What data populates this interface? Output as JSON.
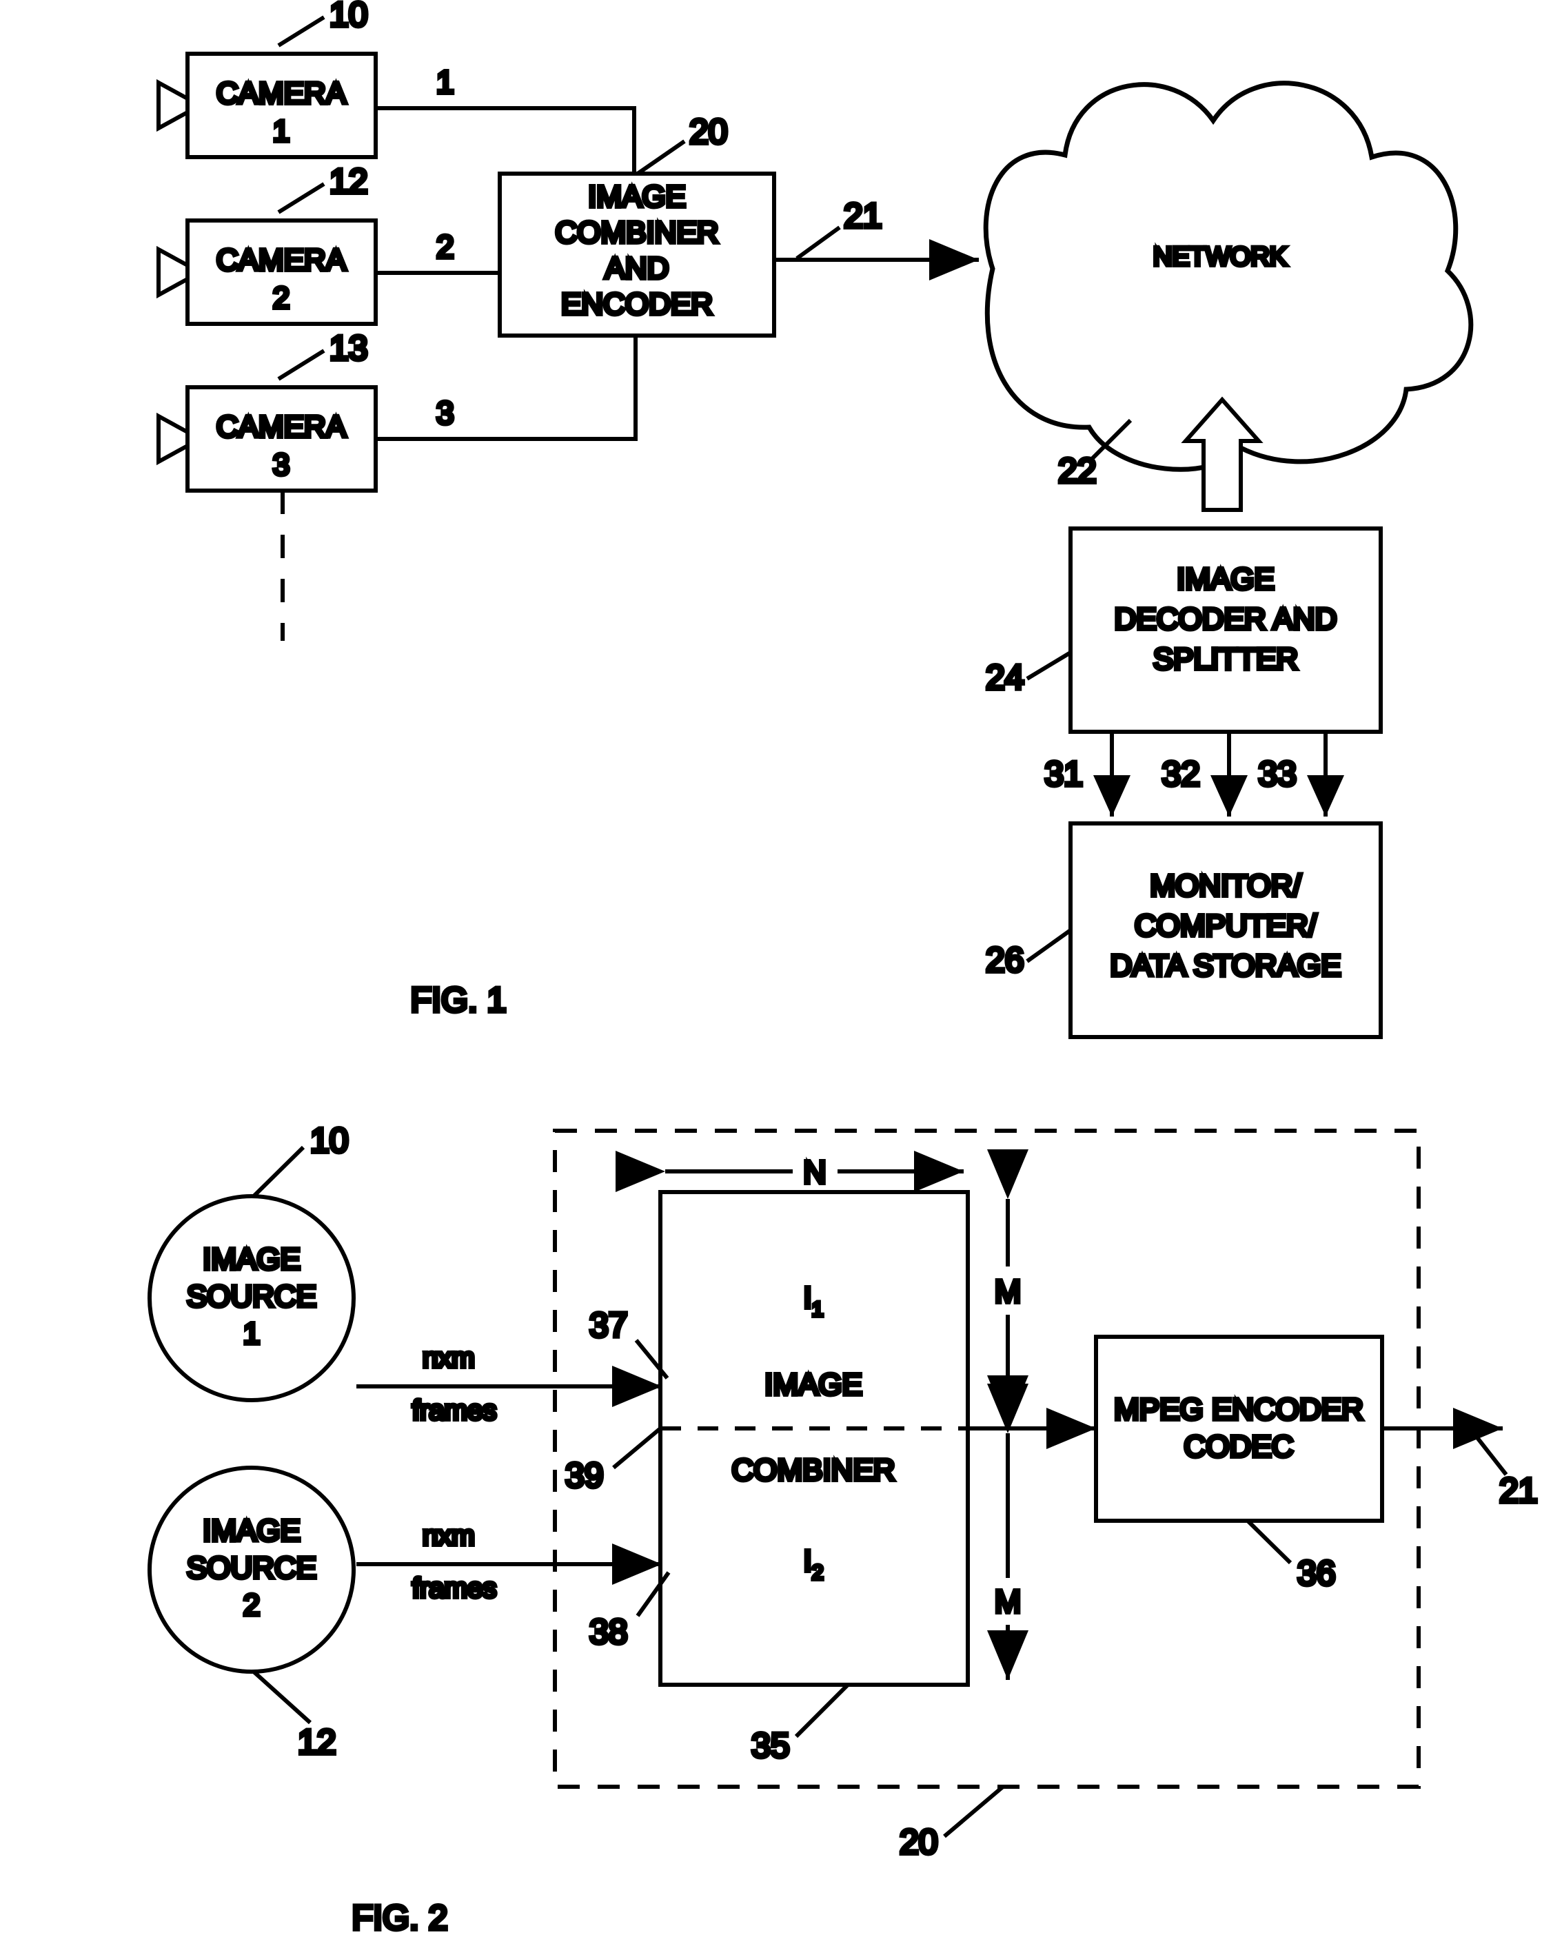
{
  "document": {
    "type": "patent-drawing",
    "figures": [
      "FIG. 1",
      "FIG. 2"
    ]
  },
  "fig1": {
    "caption": "FIG. 1",
    "cameras": [
      {
        "line1": "CAMERA",
        "line2": "1",
        "ref": "10",
        "signal": "1"
      },
      {
        "line1": "CAMERA",
        "line2": "2",
        "ref": "12",
        "signal": "2"
      },
      {
        "line1": "CAMERA",
        "line2": "3",
        "ref": "13",
        "signal": "3"
      }
    ],
    "combiner": {
      "lines": [
        "IMAGE",
        "COMBINER",
        "AND",
        "ENCODER"
      ],
      "ref": "20",
      "output_ref": "21"
    },
    "network": {
      "label": "NETWORK",
      "ref": "22"
    },
    "decoder": {
      "lines": [
        "IMAGE",
        "DECODER AND",
        "SPLITTER"
      ],
      "ref": "24",
      "outputs": [
        "31",
        "32",
        "33"
      ]
    },
    "sink": {
      "lines": [
        "MONITOR/",
        "COMPUTER/",
        "DATA STORAGE"
      ],
      "ref": "26"
    }
  },
  "fig2": {
    "caption": "FIG. 2",
    "sources": [
      {
        "line1": "IMAGE",
        "line2": "SOURCE",
        "line3": "1",
        "ref": "10",
        "flow_line1": "nxm",
        "flow_line2": "frames",
        "input_ref": "37"
      },
      {
        "line1": "IMAGE",
        "line2": "SOURCE",
        "line3": "2",
        "ref": "12",
        "flow_line1": "nxm",
        "flow_line2": "frames",
        "input_ref": "38"
      }
    ],
    "combiner_box": {
      "lines": [
        "IMAGE",
        "COMBINER"
      ],
      "top_region_label": "I",
      "top_region_sub": "1",
      "bottom_region_label": "I",
      "bottom_region_sub": "2",
      "width_dim": "N",
      "height_dim_top": "M",
      "height_dim_bottom": "M",
      "ref": "35",
      "split_ref": "39"
    },
    "encoder": {
      "line1": "MPEG ENCODER",
      "line2": "CODEC",
      "ref": "36",
      "output_ref": "21"
    },
    "enclosure_ref": "20"
  },
  "colors": {
    "ink": "#000000",
    "paper": "#ffffff"
  }
}
